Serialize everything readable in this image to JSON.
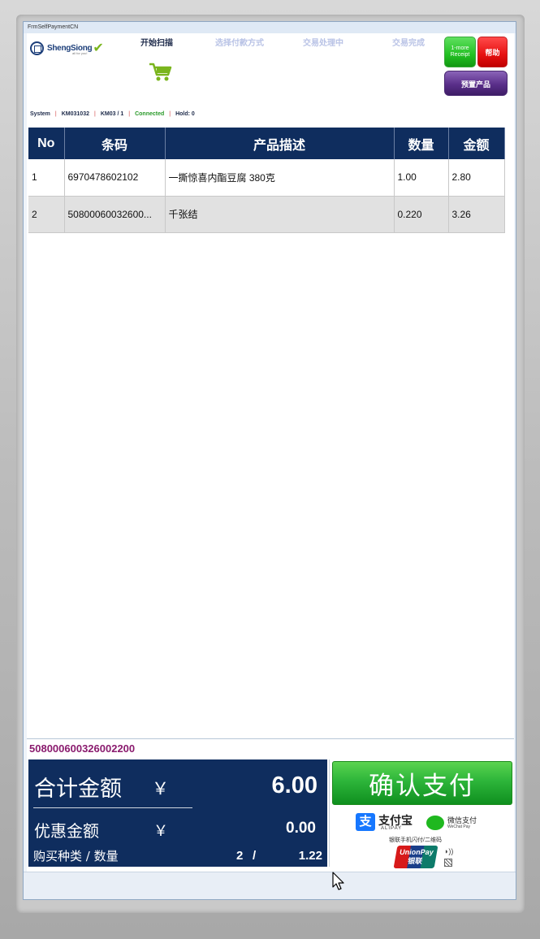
{
  "window": {
    "title": "FrmSelfPaymentCN"
  },
  "header": {
    "logo_text": "ShengSiong",
    "logo_sub": "all for you!",
    "steps": [
      "开始扫描",
      "选择付款方式",
      "交易处理中",
      "交易完成"
    ],
    "buttons": {
      "receipt_line1": "1-more",
      "receipt_line2": "Receipt",
      "help": "帮助",
      "preset": "预置产品"
    },
    "cart_icon": "shopping-cart-icon",
    "accent_green": "#7ab51d",
    "navy": "#1d3f7a"
  },
  "status": {
    "system": "System",
    "terminal": "KM031032",
    "lane": "KM03",
    "slash": "/",
    "lane_no": "1",
    "connection": "Connected",
    "hold": "Hold: 0"
  },
  "table": {
    "columns": [
      "No",
      "条码",
      "产品描述",
      "数量",
      "金额"
    ],
    "rows": [
      {
        "no": "1",
        "barcode": "6970478602102",
        "description": "一撕惊喜内酯豆腐 380克",
        "qty": "1.00",
        "amount": "2.80"
      },
      {
        "no": "2",
        "barcode": "50800060032600...",
        "description": "千张结",
        "qty": "0.220",
        "amount": "3.26"
      }
    ],
    "header_color": "#0f2d5e"
  },
  "scan": {
    "value": "508000600326002200",
    "color": "#8a1b6e"
  },
  "totals": {
    "total_label": "合计金额",
    "currency": "￥",
    "total_value": "6.00",
    "discount_label": "优惠金额",
    "discount_value": "0.00",
    "items_label": "购买种类 / 数量",
    "kinds": "2",
    "slash": "/",
    "quantity": "1.22"
  },
  "payment": {
    "confirm_label": "确认支付",
    "alipay_mark": "支",
    "alipay_name": "支付宝",
    "alipay_sub": "ALIPAY",
    "wechat_name": "微信支付",
    "wechat_sub": "WeChat Pay",
    "qr_line": "银联手机闪付/二维码",
    "unionpay_line1": "UnionPay",
    "unionpay_line2": "银联",
    "nfc_icon": "nfc-icon",
    "qr_icon": "qr-code-icon"
  }
}
